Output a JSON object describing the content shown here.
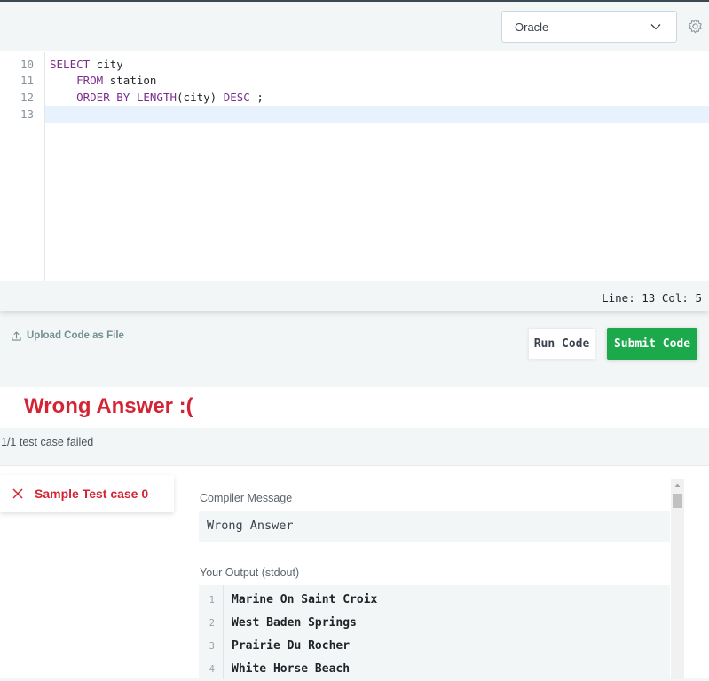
{
  "toolbar": {
    "language": "Oracle"
  },
  "editor": {
    "lines": [
      {
        "num": "10",
        "code": "SELECT city"
      },
      {
        "num": "11",
        "code": "    FROM station"
      },
      {
        "num": "12",
        "code": "    ORDER BY LENGTH(city) DESC ;"
      },
      {
        "num": "13",
        "code": ""
      }
    ],
    "status": "Line: 13 Col: 5"
  },
  "actions": {
    "upload_label": "Upload Code as File",
    "run_label": "Run Code",
    "submit_label": "Submit Code"
  },
  "result": {
    "title": "Wrong Answer :(",
    "failed_summary": "1/1 test case failed",
    "test_case_label": "Sample Test case 0",
    "compiler_message_label": "Compiler Message",
    "compiler_message": "Wrong Answer",
    "output_label": "Your Output (stdout)",
    "output_lines": [
      {
        "num": "1",
        "text": "Marine On Saint Croix"
      },
      {
        "num": "2",
        "text": "West Baden Springs"
      },
      {
        "num": "3",
        "text": "Prairie Du Rocher"
      },
      {
        "num": "4",
        "text": "White Horse Beach"
      }
    ]
  },
  "colors": {
    "error_red": "#d42434",
    "submit_green": "#1ba94c",
    "keyword_purple": "#7b2e8e"
  }
}
